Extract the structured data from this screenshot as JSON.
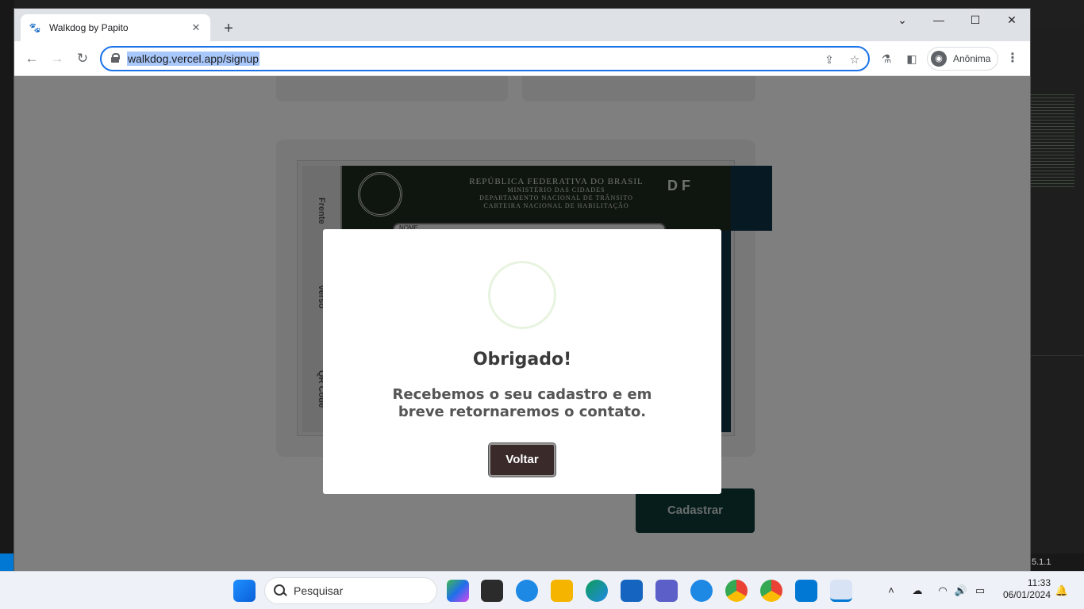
{
  "browser": {
    "tab_title": "Walkdog by Papito",
    "url": "walkdog.vercel.app/signup",
    "profile_label": "Anônima"
  },
  "page": {
    "cadastrar_button": "Cadastrar",
    "cnh_header_lines": [
      "REPÚBLICA FEDERATIVA DO BRASIL",
      "MINISTÉRIO DAS CIDADES",
      "DEPARTAMENTO NACIONAL DE TRÂNSITO",
      "CARTEIRA NACIONAL DE HABILITAÇÃO"
    ],
    "cnh_side_labels": [
      "Frente",
      "Verso",
      "QR Code"
    ],
    "cnh_df": "D F",
    "cnh_name_label": "NOME"
  },
  "modal": {
    "title": "Obrigado!",
    "message": "Recebemos o seu cadastro e em breve retornaremos o contato.",
    "button": "Voltar"
  },
  "taskbar": {
    "search_placeholder": "Pesquisar",
    "time": "11:33",
    "date": "06/01/2024"
  },
  "vscode": {
    "status_version": "5.1.1"
  },
  "colors": {
    "accent": "#1a73e8",
    "cadastrar_bg": "#0f3a38",
    "modal_button_bg": "#3a2a2a"
  }
}
